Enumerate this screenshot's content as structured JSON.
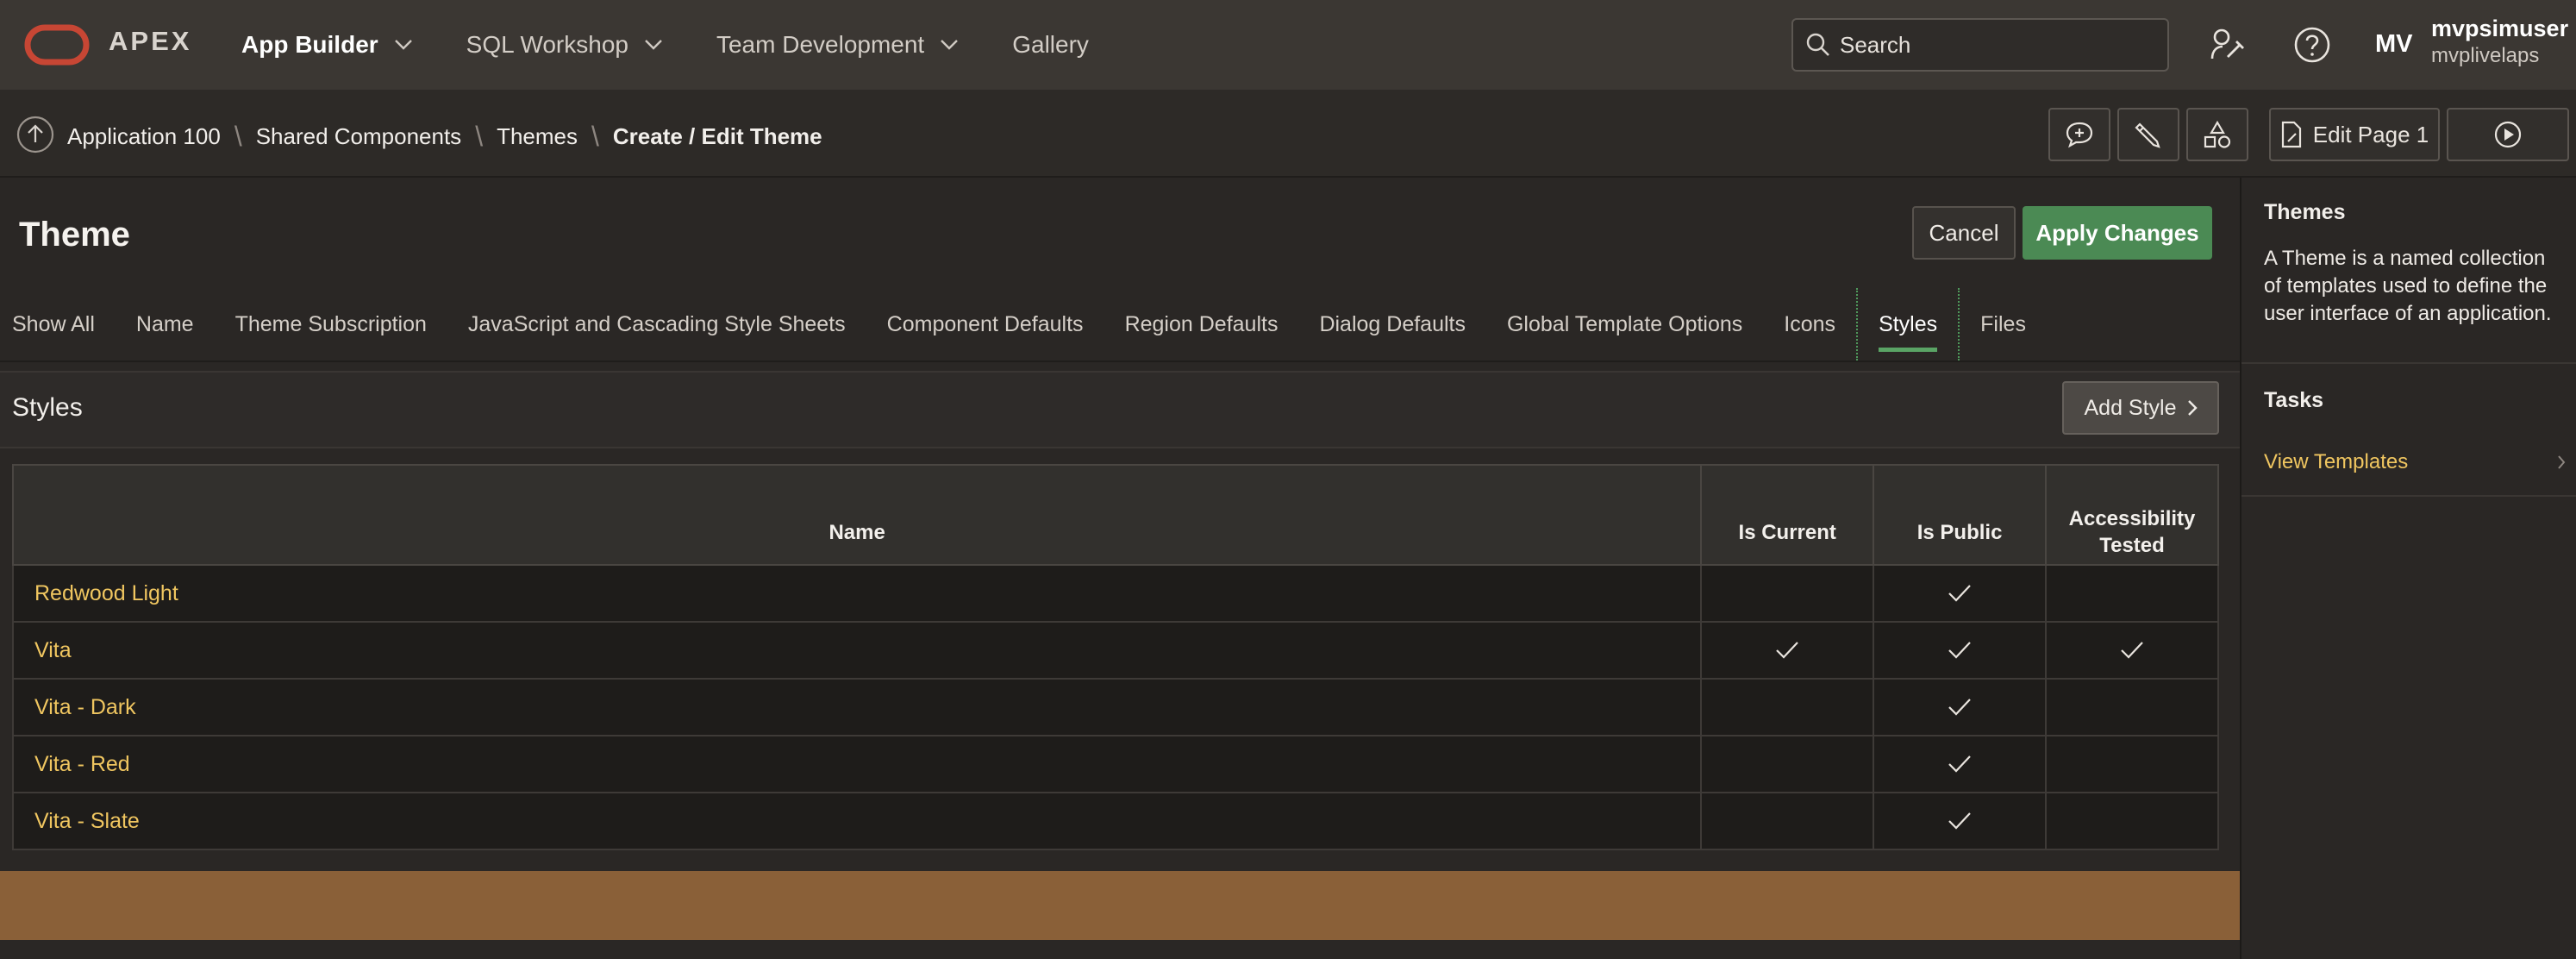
{
  "header": {
    "brand": "APEX",
    "nav": [
      {
        "label": "App Builder",
        "active": true,
        "has_menu": true
      },
      {
        "label": "SQL Workshop",
        "active": false,
        "has_menu": true
      },
      {
        "label": "Team Development",
        "active": false,
        "has_menu": true
      },
      {
        "label": "Gallery",
        "active": false,
        "has_menu": false
      }
    ],
    "search_placeholder": "Search",
    "user_initials": "MV",
    "user_name": "mvpsimuser",
    "workspace": "mvplivelaps",
    "icons": [
      "search-icon",
      "admin-wrench-icon",
      "help-icon"
    ]
  },
  "breadcrumb": {
    "items": [
      "Application 100",
      "Shared Components",
      "Themes"
    ],
    "current": "Create / Edit Theme"
  },
  "toolbar": {
    "icons": [
      "comment-icon",
      "edit-pencil-icon",
      "shapes-icon"
    ],
    "edit_page_label": "Edit Page 1",
    "run_icon": "play-icon"
  },
  "page": {
    "title": "Theme",
    "cancel_label": "Cancel",
    "apply_label": "Apply Changes",
    "tabs": [
      "Show All",
      "Name",
      "Theme Subscription",
      "JavaScript and Cascading Style Sheets",
      "Component Defaults",
      "Region Defaults",
      "Dialog Defaults",
      "Global Template Options",
      "Icons",
      "Styles",
      "Files"
    ],
    "active_tab": "Styles"
  },
  "styles_region": {
    "title": "Styles",
    "add_label": "Add Style",
    "columns": [
      "Name",
      "Is Current",
      "Is Public",
      "Accessibility Tested"
    ],
    "rows": [
      {
        "name": "Redwood Light",
        "is_current": false,
        "is_public": true,
        "accessibility_tested": false
      },
      {
        "name": "Vita",
        "is_current": true,
        "is_public": true,
        "accessibility_tested": true
      },
      {
        "name": "Vita - Dark",
        "is_current": false,
        "is_public": true,
        "accessibility_tested": false
      },
      {
        "name": "Vita - Red",
        "is_current": false,
        "is_public": true,
        "accessibility_tested": false
      },
      {
        "name": "Vita - Slate",
        "is_current": false,
        "is_public": true,
        "accessibility_tested": false
      }
    ]
  },
  "side_panel": {
    "themes_title": "Themes",
    "themes_description": "A Theme is a named collection of templates used to define the user interface of an application.",
    "tasks_title": "Tasks",
    "tasks": [
      "View Templates"
    ]
  },
  "colors": {
    "header_bg": "#3b3733",
    "accent_green": "#4b8a54",
    "link_gold": "#f0c660",
    "logo_red": "#c74634",
    "band_orange": "#8a6038"
  }
}
